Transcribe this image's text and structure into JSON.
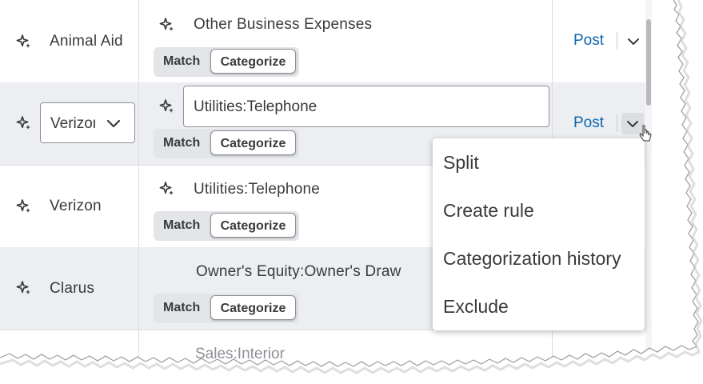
{
  "rows": [
    {
      "payee": "Animal Aid",
      "account": "Other Business Expenses",
      "match_label": "Match",
      "categorize_label": "Categorize",
      "post_label": "Post"
    },
    {
      "payee_select_value": "Verizon",
      "account_input_value": "Utilities:Telephone",
      "match_label": "Match",
      "categorize_label": "Categorize",
      "post_label": "Post"
    },
    {
      "payee": "Verizon",
      "account": "Utilities:Telephone",
      "match_label": "Match",
      "categorize_label": "Categorize"
    },
    {
      "payee": "Clarus",
      "account": "Owner's Equity:Owner's Draw",
      "match_label": "Match",
      "categorize_label": "Categorize"
    }
  ],
  "partial_next_row_text": "Sales:Interior",
  "dropdown_menu": {
    "items": [
      "Split",
      "Create rule",
      "Categorization history",
      "Exclude"
    ]
  },
  "icons": {
    "row_sparkle": "sparkle-icon",
    "dropdown": "chevron-down-icon",
    "pointer": "mouse-cursor-icon"
  },
  "colors": {
    "post_link": "#0d66b0",
    "row_alt_bg": "#eceef1",
    "text": "#393a3d",
    "segment_bg": "#e3e5e8"
  }
}
